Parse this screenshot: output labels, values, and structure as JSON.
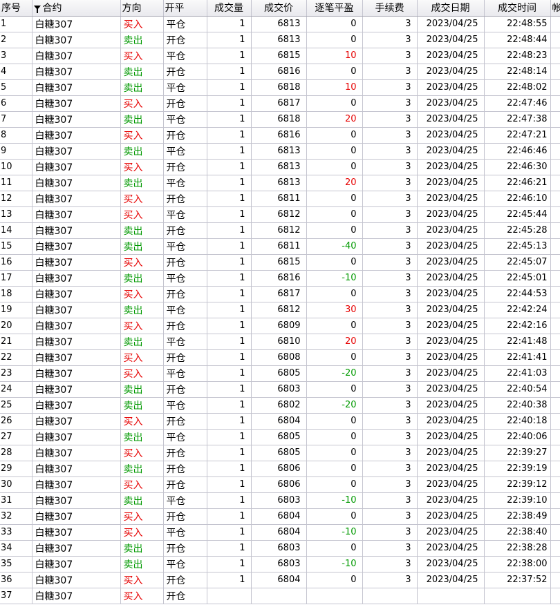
{
  "headers": [
    "序号",
    "合约",
    "方向",
    "开平",
    "成交量",
    "成交价",
    "逐笔平盈",
    "手续费",
    "成交日期",
    "成交时间",
    "帐"
  ],
  "symbol": "白糖307",
  "trade_date": "2023/04/25",
  "colors": {
    "buy": "#e60000",
    "sell": "#009900",
    "profit": "#e60000",
    "loss": "#009900"
  },
  "rows": [
    {
      "no": "1",
      "dir": "买入",
      "oc": "平仓",
      "qty": "1",
      "price": "6813",
      "pnl": "0",
      "fee": "3",
      "time": "22:48:55"
    },
    {
      "no": "2",
      "dir": "卖出",
      "oc": "开仓",
      "qty": "1",
      "price": "6813",
      "pnl": "0",
      "fee": "3",
      "time": "22:48:44"
    },
    {
      "no": "3",
      "dir": "买入",
      "oc": "平仓",
      "qty": "1",
      "price": "6815",
      "pnl": "10",
      "fee": "3",
      "time": "22:48:23"
    },
    {
      "no": "4",
      "dir": "卖出",
      "oc": "开仓",
      "qty": "1",
      "price": "6816",
      "pnl": "0",
      "fee": "3",
      "time": "22:48:14"
    },
    {
      "no": "5",
      "dir": "卖出",
      "oc": "平仓",
      "qty": "1",
      "price": "6818",
      "pnl": "10",
      "fee": "3",
      "time": "22:48:02"
    },
    {
      "no": "6",
      "dir": "买入",
      "oc": "开仓",
      "qty": "1",
      "price": "6817",
      "pnl": "0",
      "fee": "3",
      "time": "22:47:46"
    },
    {
      "no": "7",
      "dir": "卖出",
      "oc": "平仓",
      "qty": "1",
      "price": "6818",
      "pnl": "20",
      "fee": "3",
      "time": "22:47:38"
    },
    {
      "no": "8",
      "dir": "买入",
      "oc": "开仓",
      "qty": "1",
      "price": "6816",
      "pnl": "0",
      "fee": "3",
      "time": "22:47:21"
    },
    {
      "no": "9",
      "dir": "卖出",
      "oc": "平仓",
      "qty": "1",
      "price": "6813",
      "pnl": "0",
      "fee": "3",
      "time": "22:46:46"
    },
    {
      "no": "10",
      "dir": "买入",
      "oc": "开仓",
      "qty": "1",
      "price": "6813",
      "pnl": "0",
      "fee": "3",
      "time": "22:46:30"
    },
    {
      "no": "11",
      "dir": "卖出",
      "oc": "平仓",
      "qty": "1",
      "price": "6813",
      "pnl": "20",
      "fee": "3",
      "time": "22:46:21"
    },
    {
      "no": "12",
      "dir": "买入",
      "oc": "开仓",
      "qty": "1",
      "price": "6811",
      "pnl": "0",
      "fee": "3",
      "time": "22:46:10"
    },
    {
      "no": "13",
      "dir": "买入",
      "oc": "平仓",
      "qty": "1",
      "price": "6812",
      "pnl": "0",
      "fee": "3",
      "time": "22:45:44"
    },
    {
      "no": "14",
      "dir": "卖出",
      "oc": "开仓",
      "qty": "1",
      "price": "6812",
      "pnl": "0",
      "fee": "3",
      "time": "22:45:28"
    },
    {
      "no": "15",
      "dir": "卖出",
      "oc": "平仓",
      "qty": "1",
      "price": "6811",
      "pnl": "-40",
      "fee": "3",
      "time": "22:45:13"
    },
    {
      "no": "16",
      "dir": "买入",
      "oc": "开仓",
      "qty": "1",
      "price": "6815",
      "pnl": "0",
      "fee": "3",
      "time": "22:45:07"
    },
    {
      "no": "17",
      "dir": "卖出",
      "oc": "平仓",
      "qty": "1",
      "price": "6816",
      "pnl": "-10",
      "fee": "3",
      "time": "22:45:01"
    },
    {
      "no": "18",
      "dir": "买入",
      "oc": "开仓",
      "qty": "1",
      "price": "6817",
      "pnl": "0",
      "fee": "3",
      "time": "22:44:53"
    },
    {
      "no": "19",
      "dir": "卖出",
      "oc": "平仓",
      "qty": "1",
      "price": "6812",
      "pnl": "30",
      "fee": "3",
      "time": "22:42:24"
    },
    {
      "no": "20",
      "dir": "买入",
      "oc": "开仓",
      "qty": "1",
      "price": "6809",
      "pnl": "0",
      "fee": "3",
      "time": "22:42:16"
    },
    {
      "no": "21",
      "dir": "卖出",
      "oc": "平仓",
      "qty": "1",
      "price": "6810",
      "pnl": "20",
      "fee": "3",
      "time": "22:41:48"
    },
    {
      "no": "22",
      "dir": "买入",
      "oc": "开仓",
      "qty": "1",
      "price": "6808",
      "pnl": "0",
      "fee": "3",
      "time": "22:41:41"
    },
    {
      "no": "23",
      "dir": "买入",
      "oc": "平仓",
      "qty": "1",
      "price": "6805",
      "pnl": "-20",
      "fee": "3",
      "time": "22:41:03"
    },
    {
      "no": "24",
      "dir": "卖出",
      "oc": "开仓",
      "qty": "1",
      "price": "6803",
      "pnl": "0",
      "fee": "3",
      "time": "22:40:54"
    },
    {
      "no": "25",
      "dir": "卖出",
      "oc": "平仓",
      "qty": "1",
      "price": "6802",
      "pnl": "-20",
      "fee": "3",
      "time": "22:40:38"
    },
    {
      "no": "26",
      "dir": "买入",
      "oc": "开仓",
      "qty": "1",
      "price": "6804",
      "pnl": "0",
      "fee": "3",
      "time": "22:40:18"
    },
    {
      "no": "27",
      "dir": "卖出",
      "oc": "平仓",
      "qty": "1",
      "price": "6805",
      "pnl": "0",
      "fee": "3",
      "time": "22:40:06"
    },
    {
      "no": "28",
      "dir": "买入",
      "oc": "开仓",
      "qty": "1",
      "price": "6805",
      "pnl": "0",
      "fee": "3",
      "time": "22:39:27"
    },
    {
      "no": "29",
      "dir": "卖出",
      "oc": "开仓",
      "qty": "1",
      "price": "6806",
      "pnl": "0",
      "fee": "3",
      "time": "22:39:19"
    },
    {
      "no": "30",
      "dir": "买入",
      "oc": "开仓",
      "qty": "1",
      "price": "6806",
      "pnl": "0",
      "fee": "3",
      "time": "22:39:12"
    },
    {
      "no": "31",
      "dir": "卖出",
      "oc": "平仓",
      "qty": "1",
      "price": "6803",
      "pnl": "-10",
      "fee": "3",
      "time": "22:39:10"
    },
    {
      "no": "32",
      "dir": "买入",
      "oc": "开仓",
      "qty": "1",
      "price": "6804",
      "pnl": "0",
      "fee": "3",
      "time": "22:38:49"
    },
    {
      "no": "33",
      "dir": "买入",
      "oc": "平仓",
      "qty": "1",
      "price": "6804",
      "pnl": "-10",
      "fee": "3",
      "time": "22:38:40"
    },
    {
      "no": "34",
      "dir": "卖出",
      "oc": "开仓",
      "qty": "1",
      "price": "6803",
      "pnl": "0",
      "fee": "3",
      "time": "22:38:28"
    },
    {
      "no": "35",
      "dir": "卖出",
      "oc": "平仓",
      "qty": "1",
      "price": "6803",
      "pnl": "-10",
      "fee": "3",
      "time": "22:38:00"
    },
    {
      "no": "36",
      "dir": "买入",
      "oc": "开仓",
      "qty": "1",
      "price": "6804",
      "pnl": "0",
      "fee": "3",
      "time": "22:37:52"
    },
    {
      "no": "37",
      "dir": "买入",
      "oc": "开仓",
      "qty": "",
      "price": "",
      "pnl": "",
      "fee": "",
      "time": ""
    }
  ]
}
